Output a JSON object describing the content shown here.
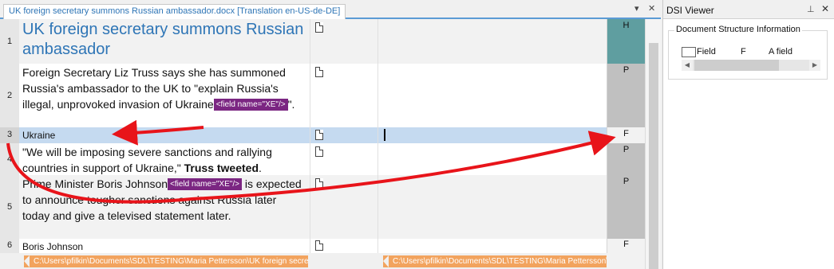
{
  "tab": {
    "title": "UK foreign secretary summons Russian ambassador.docx [Translation en-US-de-DE]",
    "dropdown_glyph": "▾",
    "close_glyph": "✕"
  },
  "rows": [
    {
      "num": "1",
      "source": "UK foreign secretary summons Russian ambassador",
      "structure": "H"
    },
    {
      "num": "2",
      "source_before": "Foreign Secretary Liz Truss says she has summoned Russia's ambassador to the UK to \"explain Russia's illegal, unprovoked invasion of Ukraine",
      "tag": "<field name=\"XE\"/>",
      "source_after": "\".",
      "structure": "P"
    },
    {
      "num": "3",
      "source": "Ukraine",
      "structure": "F"
    },
    {
      "num": "4",
      "source_before": "\"We will be imposing severe sanctions and rallying countries in support of Ukraine,\" ",
      "source_bold": "Truss tweeted",
      "source_after": ".",
      "structure": "P"
    },
    {
      "num": "5",
      "source_before": "Prime Minister Boris Johnson",
      "tag": "<field name=\"XE\"/>",
      "source_after": " is expected to announce tougher sanctions against Russia later today and give a televised statement later.",
      "structure": "P"
    },
    {
      "num": "6",
      "source": "Boris Johnson",
      "structure": "F"
    }
  ],
  "paths": {
    "source": "C:\\Users\\pfilkin\\Documents\\SDL\\TESTING\\Maria Pettersson\\UK foreign secretary summons Russian ambassador.docx",
    "target": "C:\\Users\\pfilkin\\Documents\\SDL\\TESTING\\Maria Pettersson\\UK foreign secretary summons Russian ambassador.docx"
  },
  "dsi": {
    "title": "DSI Viewer",
    "pin_glyph": "⊥",
    "close_glyph": "✕",
    "group_title": "Document Structure Information",
    "legend": {
      "col1": "Field",
      "col2": "F",
      "col3": "A field"
    }
  },
  "colors": {
    "heading_blue": "#2e75b6",
    "tag_purple": "#7b2682",
    "struct_H": "#5f9ea0",
    "struct_P": "#c0c0c0",
    "struct_F": "#f2f2f2",
    "selected_row": "#c5daf0",
    "path_orange": "#f2a35e",
    "arrow_red": "#e8141a"
  }
}
